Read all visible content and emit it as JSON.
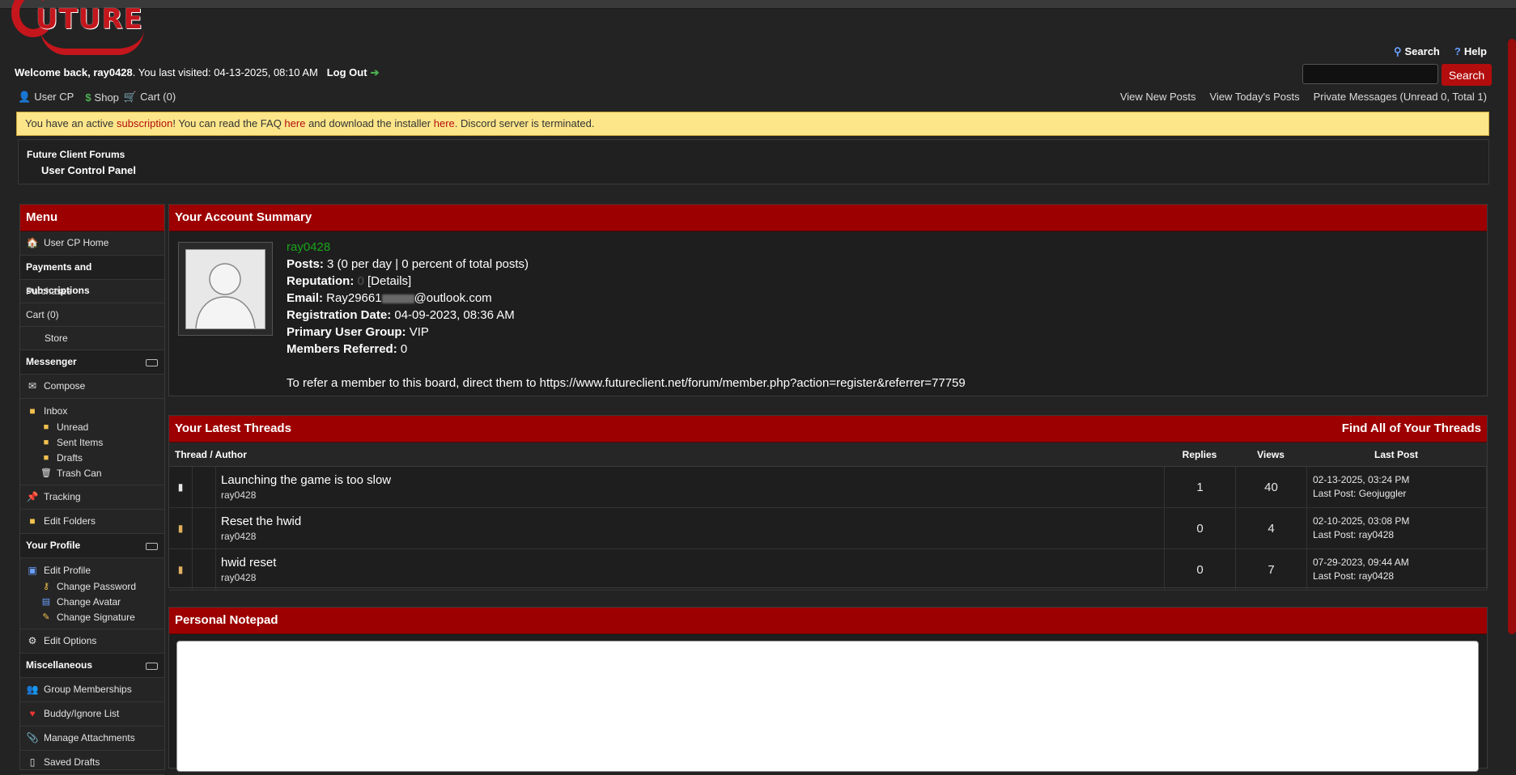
{
  "logo": {
    "text": "UTURE"
  },
  "header": {
    "welcome_prefix": "Welcome back,",
    "username": "ray0428",
    "last_visited": ". You last visited: 04-13-2025, 08:10 AM",
    "logout": "Log Out",
    "search_link": "Search",
    "help_link": "Help",
    "search_button": "Search"
  },
  "nav": {
    "user_cp": "User CP",
    "shop": "Shop",
    "cart": "Cart (0)",
    "view_new": "View New Posts",
    "view_today": "View Today's Posts",
    "pm": "Private Messages (Unread 0, Total 1)"
  },
  "notice": {
    "p1": "You have an active ",
    "link1": "subscription",
    "p2": "! You can read the FAQ ",
    "link2": "here",
    "p3": " and download the installer ",
    "link3": "here",
    "p4": ". Discord server is terminated."
  },
  "breadcrumb": {
    "forum": "Future Client Forums",
    "current": "User Control Panel"
  },
  "sidebar": {
    "title": "Menu",
    "home": "User CP Home",
    "payments": "Payments and subscriptions",
    "purchases": "Purchases",
    "cart": "Cart (0)",
    "store": "Store",
    "messenger": "Messenger",
    "compose": "Compose",
    "inbox": "Inbox",
    "unread": "Unread",
    "sent": "Sent Items",
    "drafts": "Drafts",
    "trash": "Trash Can",
    "tracking": "Tracking",
    "edit_folders": "Edit Folders",
    "your_profile": "Your Profile",
    "edit_profile": "Edit Profile",
    "change_password": "Change Password",
    "change_avatar": "Change Avatar",
    "change_signature": "Change Signature",
    "edit_options": "Edit Options",
    "misc": "Miscellaneous",
    "groups": "Group Memberships",
    "buddy": "Buddy/Ignore List",
    "attachments": "Manage Attachments",
    "saved_drafts": "Saved Drafts"
  },
  "summary": {
    "title": "Your Account Summary",
    "username": "ray0428",
    "posts_label": "Posts:",
    "posts_value": " 3 (0 per day | 0 percent of total posts)",
    "rep_label": "Reputation:",
    "rep_value": "0",
    "rep_details": " [Details]",
    "email_label": "Email:",
    "email_start": " Ray29661",
    "email_end": "@outlook.com",
    "reg_label": "Registration Date:",
    "reg_value": " 04-09-2023, 08:36 AM",
    "group_label": "Primary User Group:",
    "group_value": " VIP",
    "referred_label": "Members Referred:",
    "referred_value": " 0",
    "refer_text": "To refer a member to this board, direct them to https://www.futureclient.net/forum/member.php?action=register&referrer=77759"
  },
  "threads": {
    "title": "Your Latest Threads",
    "find_all": "Find All of Your Threads",
    "col_thread": "Thread / Author",
    "col_replies": "Replies",
    "col_views": "Views",
    "col_last": "Last Post",
    "rows": [
      {
        "title": "Launching the game is too slow",
        "author": "ray0428",
        "replies": "1",
        "views": "40",
        "last_date": "02-13-2025, 03:24 PM",
        "last_by": "Last Post: Geojuggler"
      },
      {
        "title": "Reset the hwid",
        "author": "ray0428",
        "replies": "0",
        "views": "4",
        "last_date": "02-10-2025, 03:08 PM",
        "last_by": "Last Post: ray0428"
      },
      {
        "title": "hwid reset",
        "author": "ray0428",
        "replies": "0",
        "views": "7",
        "last_date": "07-29-2023, 09:44 AM",
        "last_by": "Last Post: ray0428"
      }
    ]
  },
  "notepad": {
    "title": "Personal Notepad"
  }
}
